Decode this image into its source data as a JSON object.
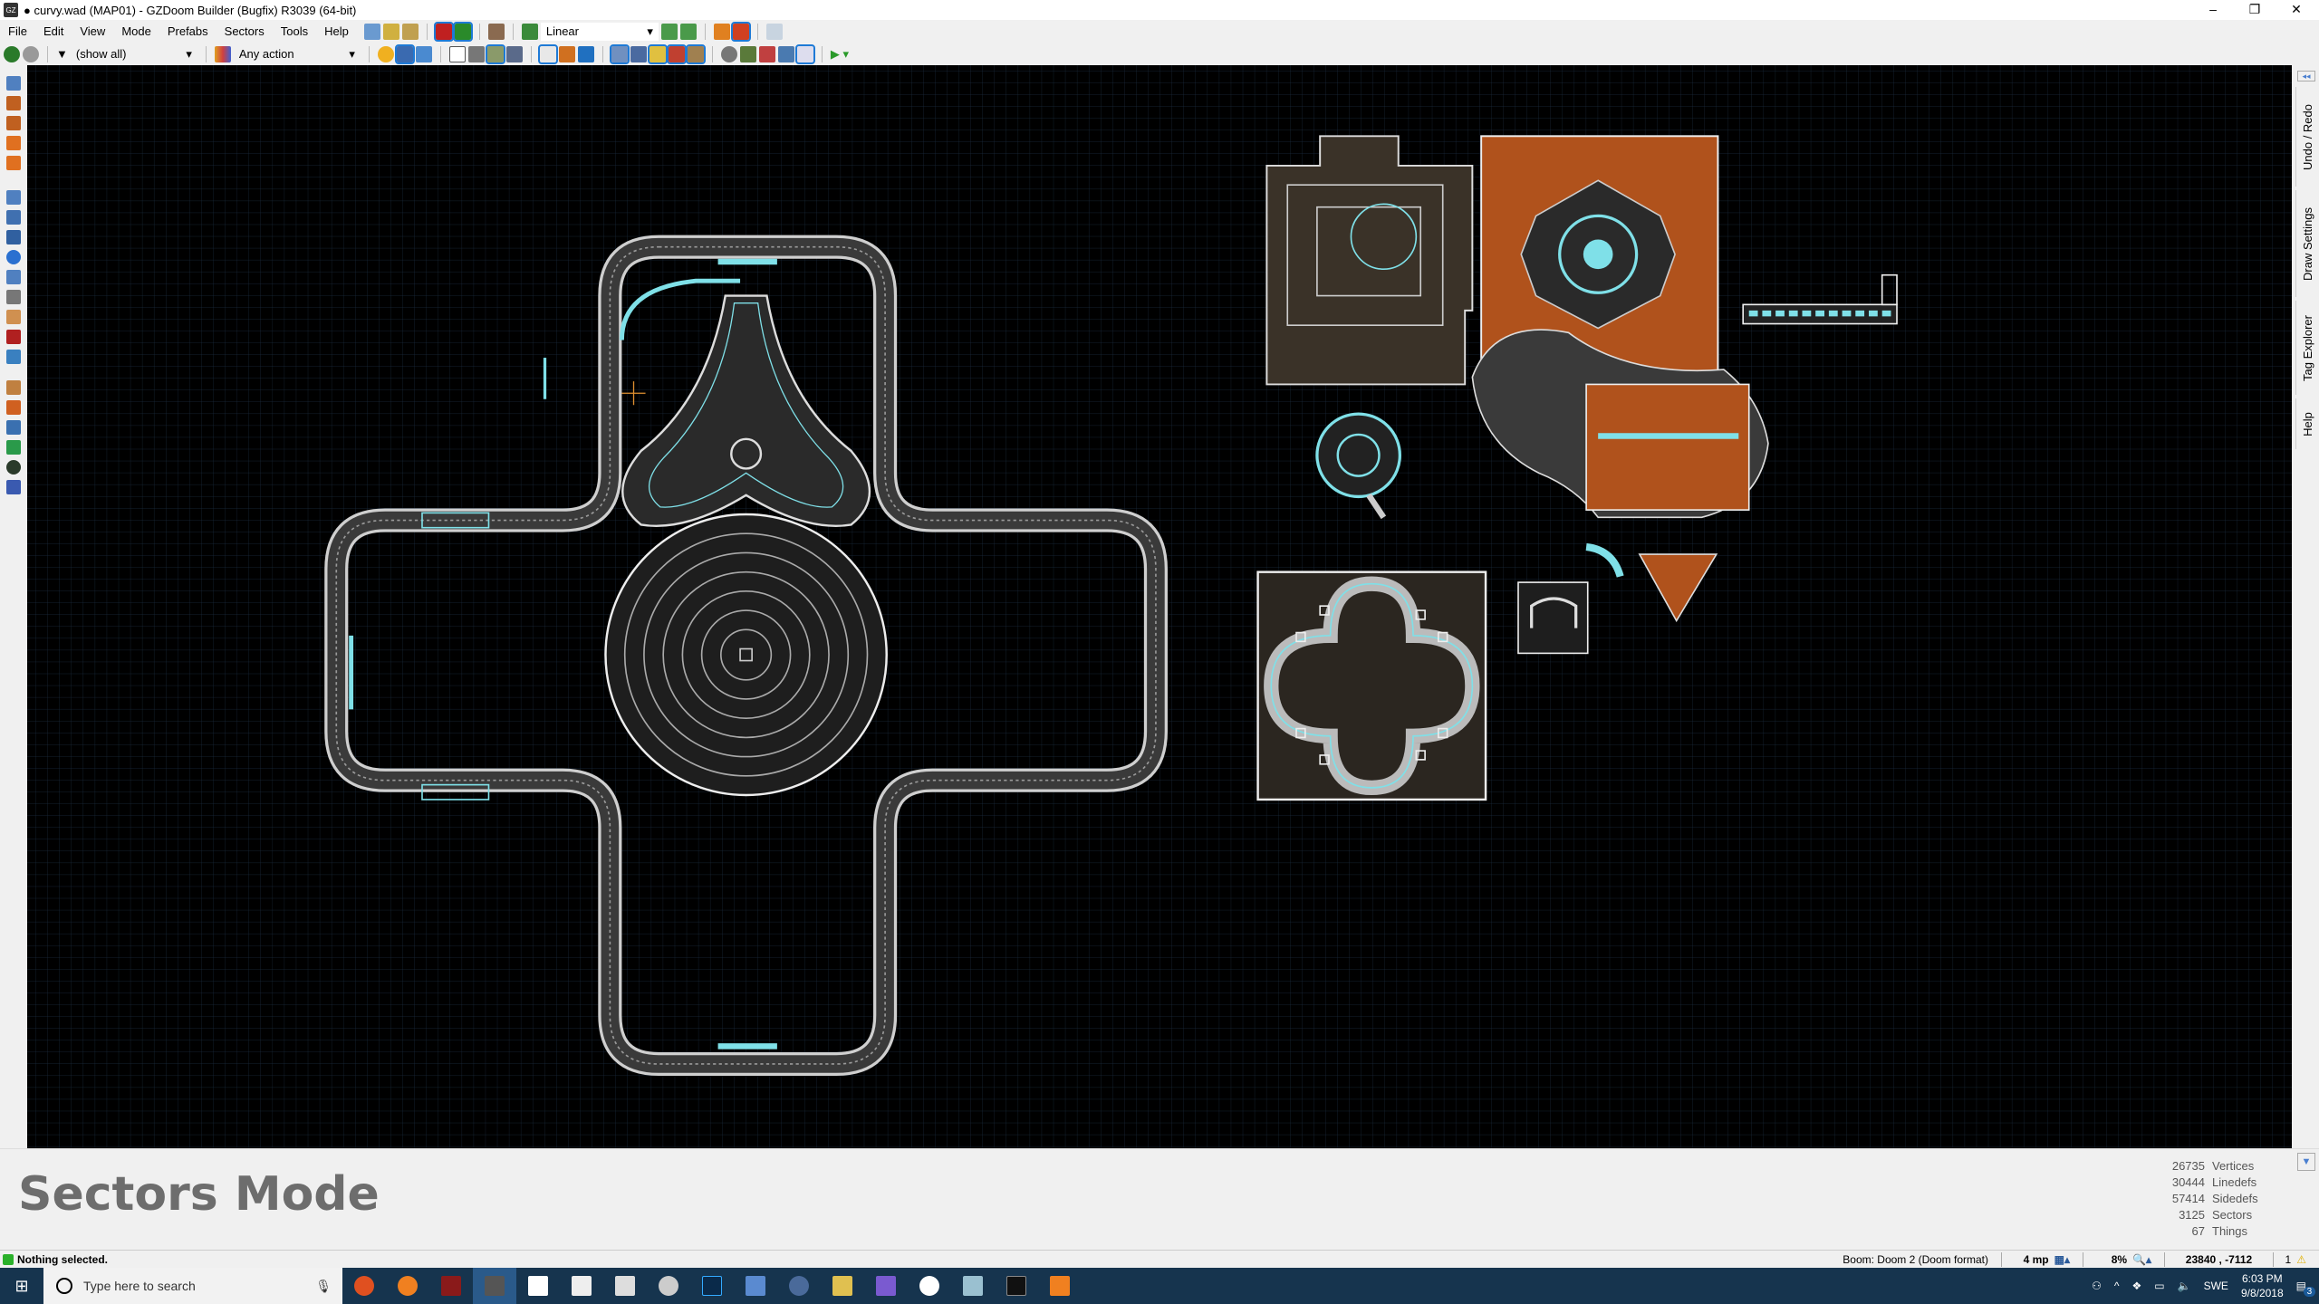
{
  "window": {
    "title": "● curvy.wad (MAP01) - GZDoom Builder (Bugfix) R3039 (64-bit)",
    "app_icon": "GZ"
  },
  "menu": [
    "File",
    "Edit",
    "View",
    "Mode",
    "Prefabs",
    "Sectors",
    "Tools",
    "Help"
  ],
  "toolbar": {
    "interpolation": "Linear",
    "filter": "(show all)",
    "action_filter": "Any action"
  },
  "right_tabs": [
    "Undo / Redo",
    "Draw Settings",
    "Tag Explorer",
    "Help"
  ],
  "info": {
    "mode_title": "Sectors Mode",
    "stats": [
      {
        "value": "26735",
        "label": "Vertices"
      },
      {
        "value": "30444",
        "label": "Linedefs"
      },
      {
        "value": "57414",
        "label": "Sidedefs"
      },
      {
        "value": "3125",
        "label": "Sectors"
      },
      {
        "value": "67",
        "label": "Things"
      }
    ]
  },
  "status": {
    "message": "Nothing selected.",
    "format": "Boom: Doom 2 (Doom format)",
    "grid": "4 mp",
    "zoom": "8%",
    "coords": "23840 , -7112",
    "warnings": "1"
  },
  "taskbar": {
    "search_placeholder": "Type here to search",
    "lang": "SWE",
    "time": "6:03 PM",
    "date": "9/8/2018",
    "notifications": "3"
  },
  "colors": {
    "canvas": "#000000",
    "grid": "#1a2a3a",
    "line": "#e8e8e8",
    "highlight": "#7fe0e8",
    "orange": "#b0521c",
    "taskbar": "#16344e"
  }
}
